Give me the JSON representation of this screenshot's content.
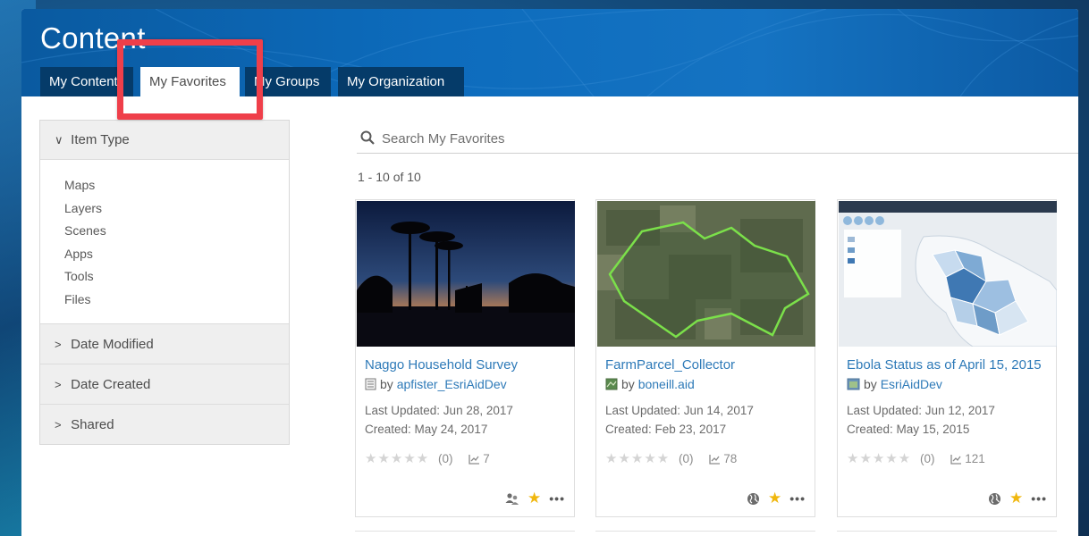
{
  "header": {
    "title": "Content",
    "tabs": [
      {
        "label": "My Content",
        "active": false
      },
      {
        "label": "My Favorites",
        "active": true
      },
      {
        "label": "My Groups",
        "active": false
      },
      {
        "label": "My Organization",
        "active": false
      }
    ]
  },
  "colors": {
    "header_blue": "#0d6cbd",
    "tab_dark": "#053b69",
    "link_blue": "#2e7ab8",
    "highlight_red": "#ef3f4a",
    "favorite_star": "#f0b70e"
  },
  "sidebar": {
    "item_type": {
      "label": "Item Type",
      "expanded": true,
      "items": [
        "Maps",
        "Layers",
        "Scenes",
        "Apps",
        "Tools",
        "Files"
      ]
    },
    "filters": [
      {
        "label": "Date Modified",
        "expanded": false
      },
      {
        "label": "Date Created",
        "expanded": false
      },
      {
        "label": "Shared",
        "expanded": false
      }
    ]
  },
  "search": {
    "placeholder": "Search My Favorites",
    "value": ""
  },
  "results": {
    "count_text": "1 - 10 of 10"
  },
  "cards": [
    {
      "title": "Naggo Household Survey",
      "by": "by",
      "owner": "apfister_EsriAidDev",
      "type_icon": "form-icon",
      "updated": "Last Updated: Jun 28, 2017",
      "created": "Created: May 24, 2017",
      "stars": "★★★★★",
      "rating_count": "(0)",
      "views": "7",
      "share_icon": "shared-users-icon",
      "thumbnail": "palm-trees-sunset"
    },
    {
      "title": "FarmParcel_Collector",
      "by": "by",
      "owner": "boneill.aid",
      "type_icon": "map-icon",
      "updated": "Last Updated: Jun 14, 2017",
      "created": "Created: Feb 23, 2017",
      "stars": "★★★★★",
      "rating_count": "(0)",
      "views": "78",
      "share_icon": "globe-icon",
      "thumbnail": "aerial-parcel-outline"
    },
    {
      "title": "Ebola Status as of April 15, 2015",
      "by": "by",
      "owner": "EsriAidDev",
      "type_icon": "web-app-icon",
      "updated": "Last Updated: Jun 12, 2017",
      "created": "Created: May 15, 2015",
      "stars": "★★★★★",
      "rating_count": "(0)",
      "views": "121",
      "share_icon": "globe-icon",
      "thumbnail": "choropleth-map"
    }
  ]
}
